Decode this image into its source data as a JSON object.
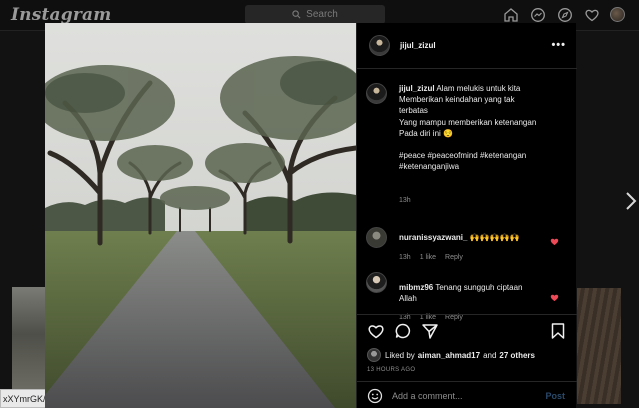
{
  "nav": {
    "logo": "Instagram",
    "search_placeholder": "Search",
    "icons": [
      "home-icon",
      "messenger-icon",
      "explore-icon",
      "heart-icon",
      "profile-avatar"
    ]
  },
  "url_hint": "xXYmrGK/",
  "post": {
    "username": "jijul_zizul",
    "caption_lines": [
      "Alam melukis untuk kita",
      "Memberikan keindahan yang tak",
      "terbatas",
      "Yang mampu memberikan ketenangan",
      "Pada diri ini 😌"
    ],
    "hashtags_lines": [
      "#peace #peaceofmind #ketenangan",
      "#ketenanganjiwa"
    ],
    "caption_time": "13h",
    "comments": [
      {
        "username": "nuranissyazwani_",
        "text": "🙌🙌🙌🙌🙌",
        "time": "13h",
        "likes": "1 like",
        "reply": "Reply"
      },
      {
        "username": "mibmz96",
        "text": "Tenang sungguh ciptaan Allah",
        "time": "13h",
        "likes": "1 like",
        "reply": "Reply"
      }
    ],
    "liked_by_prefix": "Liked by",
    "liked_by_user": "aiman_ahmad17",
    "liked_by_and": "and",
    "liked_by_others": "27 others",
    "time_ago": "13 HOURS AGO",
    "add_comment_placeholder": "Add a comment...",
    "post_label": "Post"
  },
  "colors": {
    "background": "#121212",
    "modal": "#000000",
    "like_red": "#ed4956",
    "post_blue_disabled": "#2a4a6a"
  }
}
